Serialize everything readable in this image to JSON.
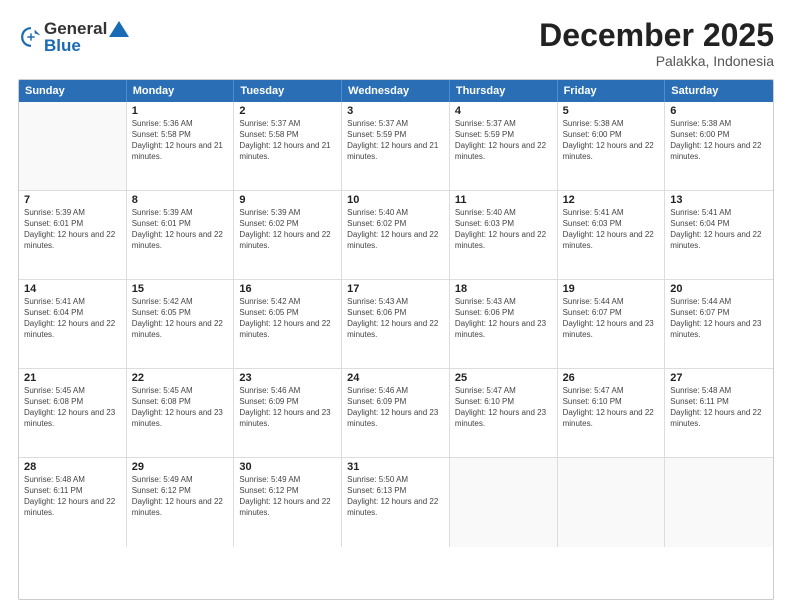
{
  "header": {
    "logo_general": "General",
    "logo_blue": "Blue",
    "month_title": "December 2025",
    "subtitle": "Palakka, Indonesia"
  },
  "calendar": {
    "days": [
      "Sunday",
      "Monday",
      "Tuesday",
      "Wednesday",
      "Thursday",
      "Friday",
      "Saturday"
    ],
    "rows": [
      [
        {
          "day": "",
          "empty": true
        },
        {
          "day": "1",
          "sunrise": "Sunrise: 5:36 AM",
          "sunset": "Sunset: 5:58 PM",
          "daylight": "Daylight: 12 hours and 21 minutes."
        },
        {
          "day": "2",
          "sunrise": "Sunrise: 5:37 AM",
          "sunset": "Sunset: 5:58 PM",
          "daylight": "Daylight: 12 hours and 21 minutes."
        },
        {
          "day": "3",
          "sunrise": "Sunrise: 5:37 AM",
          "sunset": "Sunset: 5:59 PM",
          "daylight": "Daylight: 12 hours and 21 minutes."
        },
        {
          "day": "4",
          "sunrise": "Sunrise: 5:37 AM",
          "sunset": "Sunset: 5:59 PM",
          "daylight": "Daylight: 12 hours and 22 minutes."
        },
        {
          "day": "5",
          "sunrise": "Sunrise: 5:38 AM",
          "sunset": "Sunset: 6:00 PM",
          "daylight": "Daylight: 12 hours and 22 minutes."
        },
        {
          "day": "6",
          "sunrise": "Sunrise: 5:38 AM",
          "sunset": "Sunset: 6:00 PM",
          "daylight": "Daylight: 12 hours and 22 minutes."
        }
      ],
      [
        {
          "day": "7",
          "sunrise": "Sunrise: 5:39 AM",
          "sunset": "Sunset: 6:01 PM",
          "daylight": "Daylight: 12 hours and 22 minutes."
        },
        {
          "day": "8",
          "sunrise": "Sunrise: 5:39 AM",
          "sunset": "Sunset: 6:01 PM",
          "daylight": "Daylight: 12 hours and 22 minutes."
        },
        {
          "day": "9",
          "sunrise": "Sunrise: 5:39 AM",
          "sunset": "Sunset: 6:02 PM",
          "daylight": "Daylight: 12 hours and 22 minutes."
        },
        {
          "day": "10",
          "sunrise": "Sunrise: 5:40 AM",
          "sunset": "Sunset: 6:02 PM",
          "daylight": "Daylight: 12 hours and 22 minutes."
        },
        {
          "day": "11",
          "sunrise": "Sunrise: 5:40 AM",
          "sunset": "Sunset: 6:03 PM",
          "daylight": "Daylight: 12 hours and 22 minutes."
        },
        {
          "day": "12",
          "sunrise": "Sunrise: 5:41 AM",
          "sunset": "Sunset: 6:03 PM",
          "daylight": "Daylight: 12 hours and 22 minutes."
        },
        {
          "day": "13",
          "sunrise": "Sunrise: 5:41 AM",
          "sunset": "Sunset: 6:04 PM",
          "daylight": "Daylight: 12 hours and 22 minutes."
        }
      ],
      [
        {
          "day": "14",
          "sunrise": "Sunrise: 5:41 AM",
          "sunset": "Sunset: 6:04 PM",
          "daylight": "Daylight: 12 hours and 22 minutes."
        },
        {
          "day": "15",
          "sunrise": "Sunrise: 5:42 AM",
          "sunset": "Sunset: 6:05 PM",
          "daylight": "Daylight: 12 hours and 22 minutes."
        },
        {
          "day": "16",
          "sunrise": "Sunrise: 5:42 AM",
          "sunset": "Sunset: 6:05 PM",
          "daylight": "Daylight: 12 hours and 22 minutes."
        },
        {
          "day": "17",
          "sunrise": "Sunrise: 5:43 AM",
          "sunset": "Sunset: 6:06 PM",
          "daylight": "Daylight: 12 hours and 22 minutes."
        },
        {
          "day": "18",
          "sunrise": "Sunrise: 5:43 AM",
          "sunset": "Sunset: 6:06 PM",
          "daylight": "Daylight: 12 hours and 23 minutes."
        },
        {
          "day": "19",
          "sunrise": "Sunrise: 5:44 AM",
          "sunset": "Sunset: 6:07 PM",
          "daylight": "Daylight: 12 hours and 23 minutes."
        },
        {
          "day": "20",
          "sunrise": "Sunrise: 5:44 AM",
          "sunset": "Sunset: 6:07 PM",
          "daylight": "Daylight: 12 hours and 23 minutes."
        }
      ],
      [
        {
          "day": "21",
          "sunrise": "Sunrise: 5:45 AM",
          "sunset": "Sunset: 6:08 PM",
          "daylight": "Daylight: 12 hours and 23 minutes."
        },
        {
          "day": "22",
          "sunrise": "Sunrise: 5:45 AM",
          "sunset": "Sunset: 6:08 PM",
          "daylight": "Daylight: 12 hours and 23 minutes."
        },
        {
          "day": "23",
          "sunrise": "Sunrise: 5:46 AM",
          "sunset": "Sunset: 6:09 PM",
          "daylight": "Daylight: 12 hours and 23 minutes."
        },
        {
          "day": "24",
          "sunrise": "Sunrise: 5:46 AM",
          "sunset": "Sunset: 6:09 PM",
          "daylight": "Daylight: 12 hours and 23 minutes."
        },
        {
          "day": "25",
          "sunrise": "Sunrise: 5:47 AM",
          "sunset": "Sunset: 6:10 PM",
          "daylight": "Daylight: 12 hours and 23 minutes."
        },
        {
          "day": "26",
          "sunrise": "Sunrise: 5:47 AM",
          "sunset": "Sunset: 6:10 PM",
          "daylight": "Daylight: 12 hours and 22 minutes."
        },
        {
          "day": "27",
          "sunrise": "Sunrise: 5:48 AM",
          "sunset": "Sunset: 6:11 PM",
          "daylight": "Daylight: 12 hours and 22 minutes."
        }
      ],
      [
        {
          "day": "28",
          "sunrise": "Sunrise: 5:48 AM",
          "sunset": "Sunset: 6:11 PM",
          "daylight": "Daylight: 12 hours and 22 minutes."
        },
        {
          "day": "29",
          "sunrise": "Sunrise: 5:49 AM",
          "sunset": "Sunset: 6:12 PM",
          "daylight": "Daylight: 12 hours and 22 minutes."
        },
        {
          "day": "30",
          "sunrise": "Sunrise: 5:49 AM",
          "sunset": "Sunset: 6:12 PM",
          "daylight": "Daylight: 12 hours and 22 minutes."
        },
        {
          "day": "31",
          "sunrise": "Sunrise: 5:50 AM",
          "sunset": "Sunset: 6:13 PM",
          "daylight": "Daylight: 12 hours and 22 minutes."
        },
        {
          "day": "",
          "empty": true
        },
        {
          "day": "",
          "empty": true
        },
        {
          "day": "",
          "empty": true
        }
      ]
    ]
  }
}
